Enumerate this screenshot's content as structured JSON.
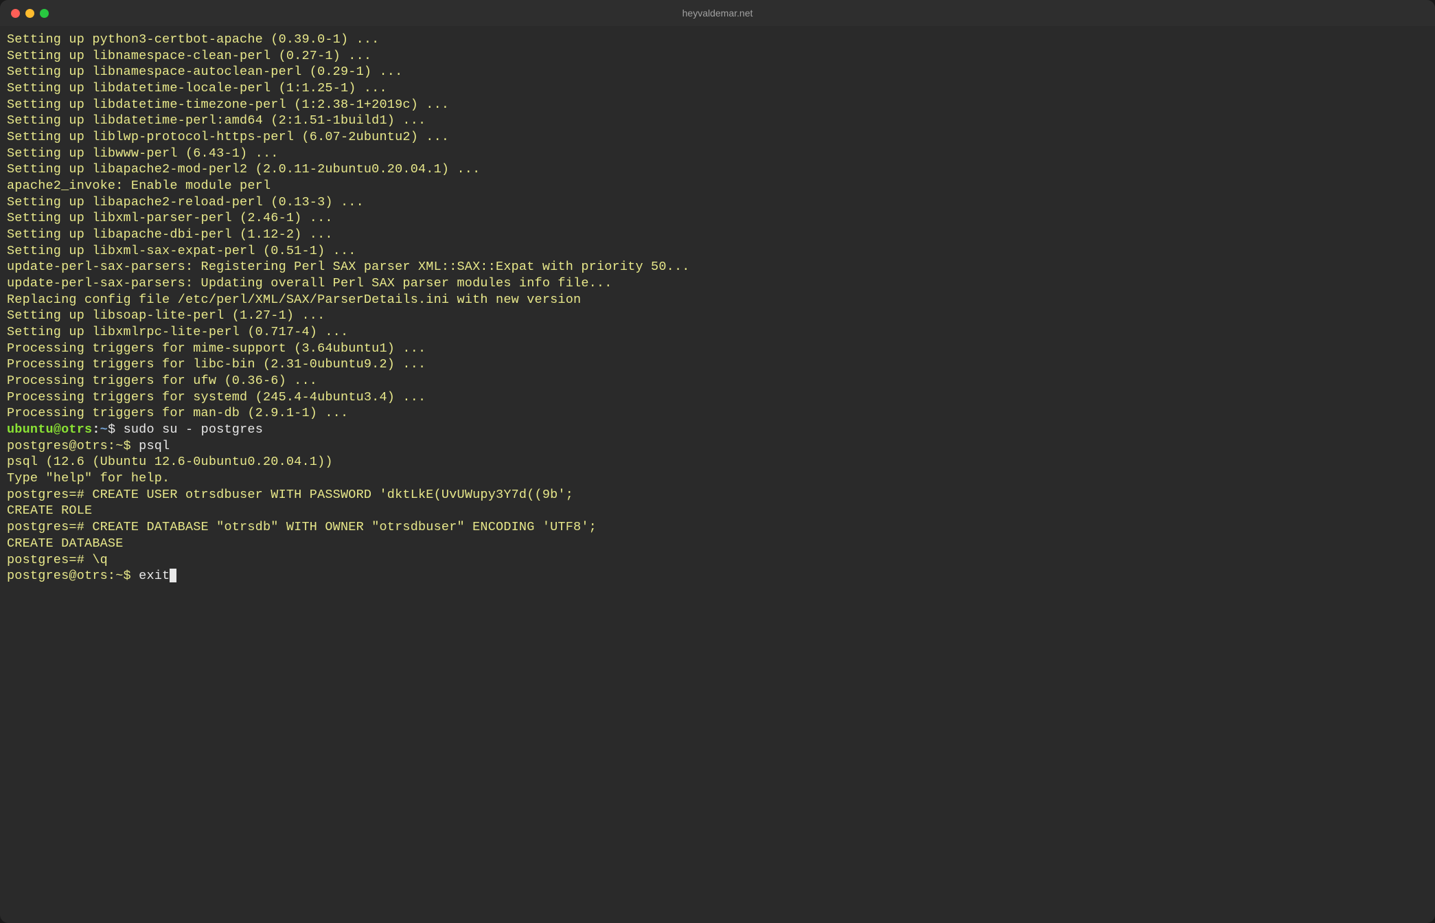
{
  "window": {
    "title": "heyvaldemar.net"
  },
  "output_lines": [
    "Setting up python3-certbot-apache (0.39.0-1) ...",
    "Setting up libnamespace-clean-perl (0.27-1) ...",
    "Setting up libnamespace-autoclean-perl (0.29-1) ...",
    "Setting up libdatetime-locale-perl (1:1.25-1) ...",
    "Setting up libdatetime-timezone-perl (1:2.38-1+2019c) ...",
    "Setting up libdatetime-perl:amd64 (2:1.51-1build1) ...",
    "Setting up liblwp-protocol-https-perl (6.07-2ubuntu2) ...",
    "Setting up libwww-perl (6.43-1) ...",
    "Setting up libapache2-mod-perl2 (2.0.11-2ubuntu0.20.04.1) ...",
    "apache2_invoke: Enable module perl",
    "Setting up libapache2-reload-perl (0.13-3) ...",
    "Setting up libxml-parser-perl (2.46-1) ...",
    "Setting up libapache-dbi-perl (1.12-2) ...",
    "Setting up libxml-sax-expat-perl (0.51-1) ...",
    "update-perl-sax-parsers: Registering Perl SAX parser XML::SAX::Expat with priority 50...",
    "update-perl-sax-parsers: Updating overall Perl SAX parser modules info file...",
    "Replacing config file /etc/perl/XML/SAX/ParserDetails.ini with new version",
    "Setting up libsoap-lite-perl (1.27-1) ...",
    "Setting up libxmlrpc-lite-perl (0.717-4) ...",
    "Processing triggers for mime-support (3.64ubuntu1) ...",
    "Processing triggers for libc-bin (2.31-0ubuntu9.2) ...",
    "Processing triggers for ufw (0.36-6) ...",
    "Processing triggers for systemd (245.4-4ubuntu3.4) ...",
    "Processing triggers for man-db (2.9.1-1) ..."
  ],
  "prompt1": {
    "user": "ubuntu@otrs",
    "sep": ":",
    "path": "~",
    "sign": "$ ",
    "command": "sudo su - postgres"
  },
  "prompt2": {
    "text": "postgres@otrs:~$ ",
    "command": "psql"
  },
  "psql_header": [
    "psql (12.6 (Ubuntu 12.6-0ubuntu0.20.04.1))",
    "Type \"help\" for help.",
    ""
  ],
  "psql_lines": [
    {
      "prompt": "postgres=# ",
      "cmd": "CREATE USER otrsdbuser WITH PASSWORD 'dktLkE(UvUWupy3Y7d((9b';"
    },
    {
      "prompt": "",
      "cmd": "CREATE ROLE"
    },
    {
      "prompt": "postgres=# ",
      "cmd": "CREATE DATABASE \"otrsdb\" WITH OWNER \"otrsdbuser\" ENCODING 'UTF8';"
    },
    {
      "prompt": "",
      "cmd": "CREATE DATABASE"
    },
    {
      "prompt": "postgres=# ",
      "cmd": "\\q"
    }
  ],
  "prompt3": {
    "text": "postgres@otrs:~$ ",
    "command": "exit"
  }
}
